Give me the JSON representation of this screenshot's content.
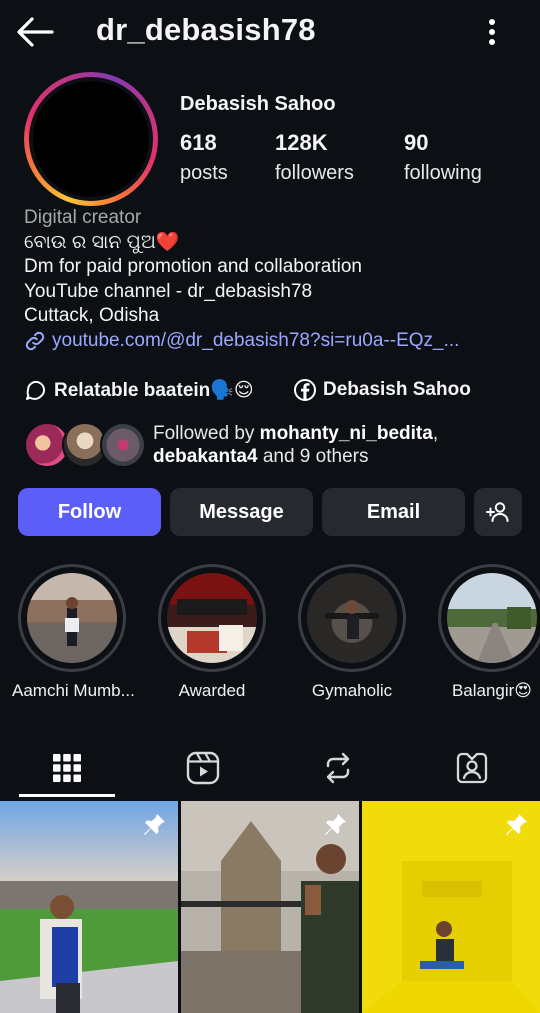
{
  "header": {
    "username": "dr_debasish78",
    "back_icon": "back-arrow-icon",
    "more_icon": "more-vertical-icon"
  },
  "profile": {
    "full_name": "Debasish Sahoo",
    "stats": [
      {
        "value": "618",
        "label": "posts"
      },
      {
        "value": "128K",
        "label": "followers"
      },
      {
        "value": "90",
        "label": "following"
      }
    ]
  },
  "bio": {
    "category": "Digital creator",
    "lines": [
      "ବୋଉ ର ସାନ ପୁଅ❤️",
      "Dm for paid promotion and collaboration",
      "YouTube channel - dr_debasish78",
      "Cuttack, Odisha"
    ],
    "link": "youtube.com/@dr_debasish78?si=ru0a--EQz_..."
  },
  "social": {
    "threads": "Relatable baatein🗣️😌",
    "facebook": "Debasish Sahoo"
  },
  "followed_by": {
    "prefix": "Followed by ",
    "user1": "mohanty_ni_bedita",
    "sep": ",",
    "user2": "debakanta4",
    "suffix": " and 9 others"
  },
  "actions": {
    "follow": "Follow",
    "message": "Message",
    "email": "Email",
    "add_user_icon": "add-user-icon"
  },
  "highlights": [
    {
      "title": "Aamchi Mumb..."
    },
    {
      "title": "Awarded"
    },
    {
      "title": "Gymaholic"
    },
    {
      "title": "Balangir😍"
    }
  ],
  "tabs": [
    "grid-icon",
    "reels-icon",
    "reposts-icon",
    "tagged-icon"
  ],
  "colors": {
    "follow_button": "#5b5ef7",
    "link": "#9aa9ff",
    "background": "#0c0f14",
    "button": "#26292f"
  }
}
